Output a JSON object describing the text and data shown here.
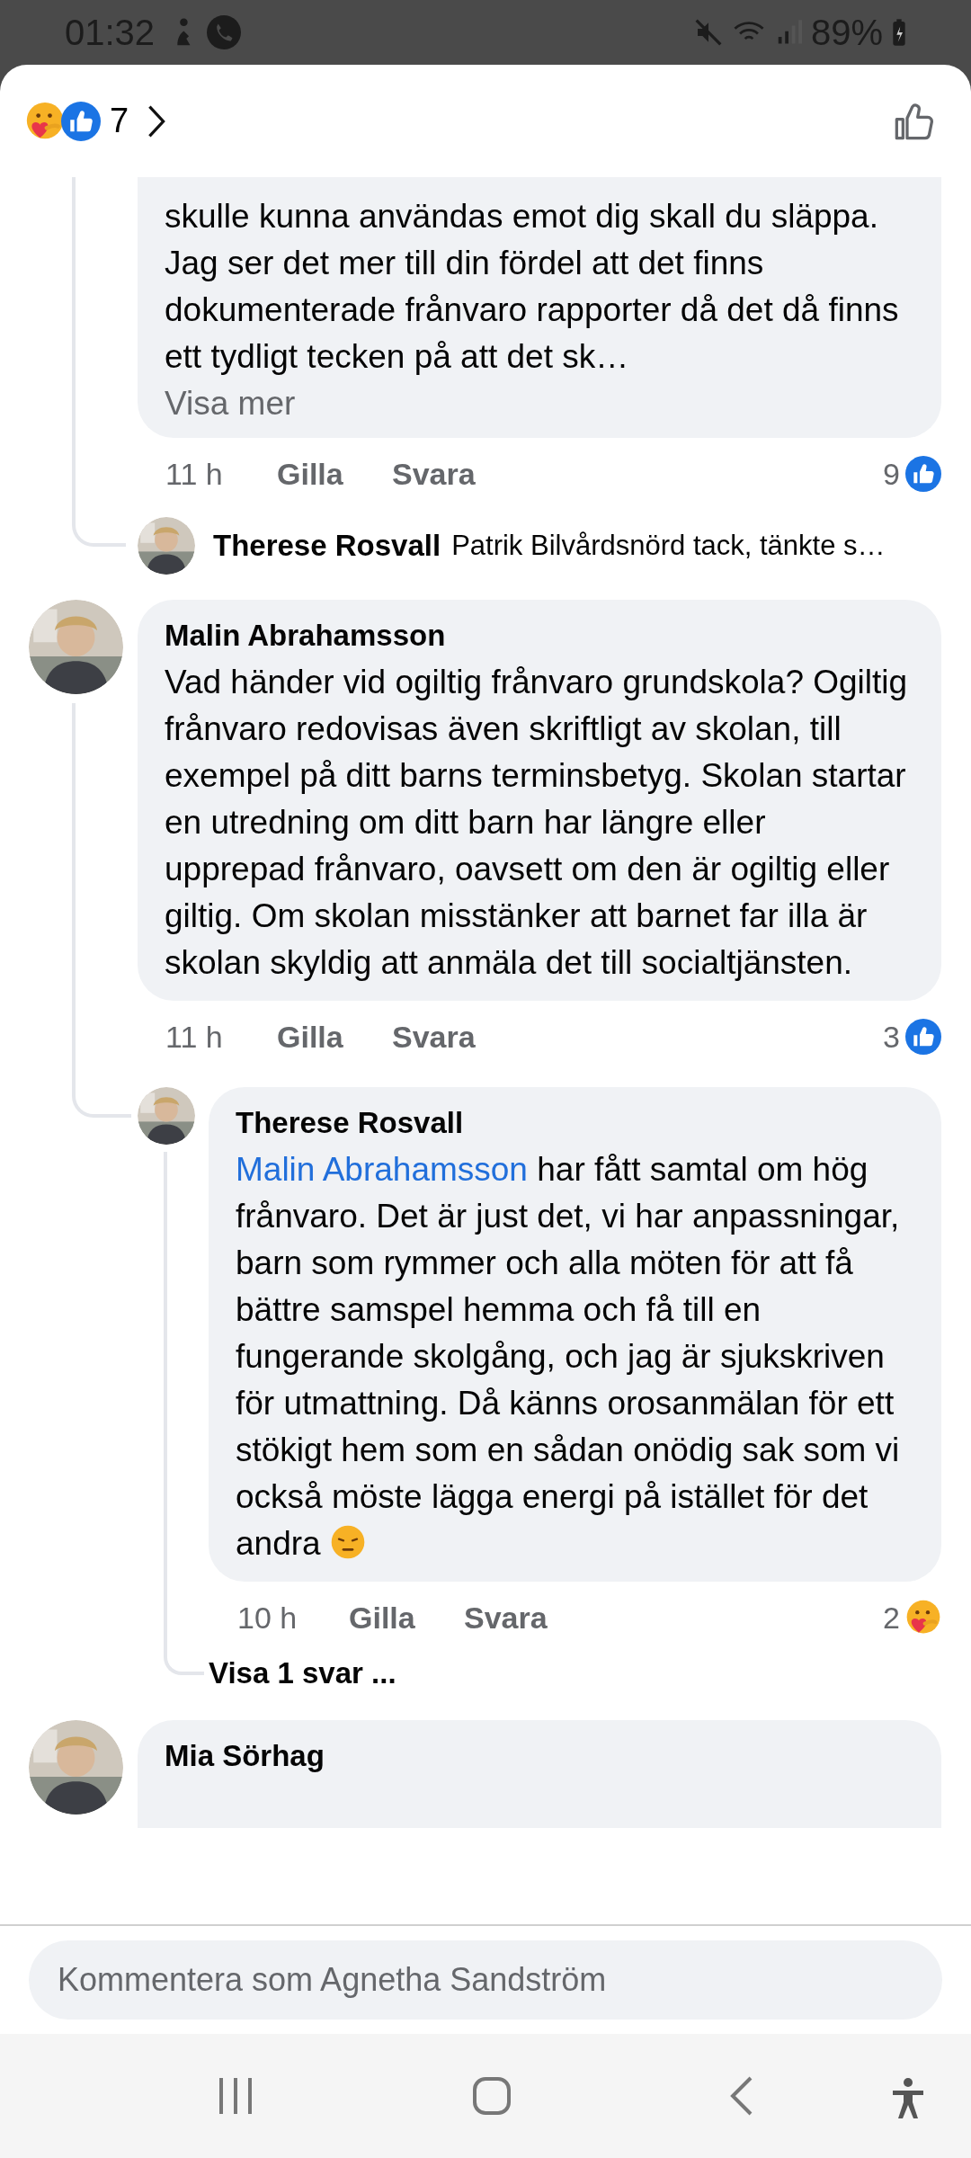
{
  "status_bar": {
    "time": "01:32",
    "battery": "89%"
  },
  "header": {
    "reactions": [
      {
        "kind": "care"
      },
      {
        "kind": "like"
      }
    ],
    "reaction_count": "7"
  },
  "comments": [
    {
      "kind": "continued",
      "text": "skulle kunna användas emot dig skall du släppa. Jag ser det mer till din fördel att det finns dokumenterade frånvaro rapporter då det då finns ett tydligt tecken på att det sk…",
      "more": "Visa mer",
      "time": "11 h",
      "like": "Gilla",
      "reply": "Svara",
      "reaction_count": "9",
      "reaction": {
        "kind": "like"
      },
      "reply_preview": {
        "author": "Therese Rosvall",
        "text": "Patrik Bilvårdsnörd tack, tänkte s…"
      }
    },
    {
      "kind": "full",
      "author": "Malin Abrahamsson",
      "text": "Vad händer vid ogiltig frånvaro grundskola? Ogiltig frånvaro redovisas även skriftligt av skolan, till exempel på ditt barns terminsbetyg. Skolan startar en utredning om ditt barn har längre eller upprepad frånvaro, oavsett om den är ogiltig eller giltig. Om skolan misstänker att barnet far illa är skolan skyldig att anmäla det till socialtjänsten.",
      "time": "11 h",
      "like": "Gilla",
      "reply": "Svara",
      "reaction_count": "3",
      "reaction": {
        "kind": "like"
      },
      "replies": [
        {
          "author": "Therese Rosvall",
          "mention": "Malin Abrahamsson",
          "text": " har fått samtal om hög frånvaro. Det är just det, vi har anpassningar, barn som rymmer och alla möten för att få bättre samspel hemma och få till en fungerande skolgång, och jag är sjukskriven  för utmattning. Då känns orosanmälan för ett stökigt hem som en sådan onödig sak som vi också möste lägga energi på istället för det andra",
          "emoji": {
            "kind": "pensive"
          },
          "time": "10 h",
          "like": "Gilla",
          "reply": "Svara",
          "reaction_count": "2",
          "reaction": {
            "kind": "care"
          },
          "more_replies": "Visa 1 svar ..."
        }
      ]
    },
    {
      "kind": "partial",
      "author": "Mia Sörhag"
    }
  ],
  "composer": {
    "placeholder": "Kommentera som Agnetha Sandström"
  }
}
